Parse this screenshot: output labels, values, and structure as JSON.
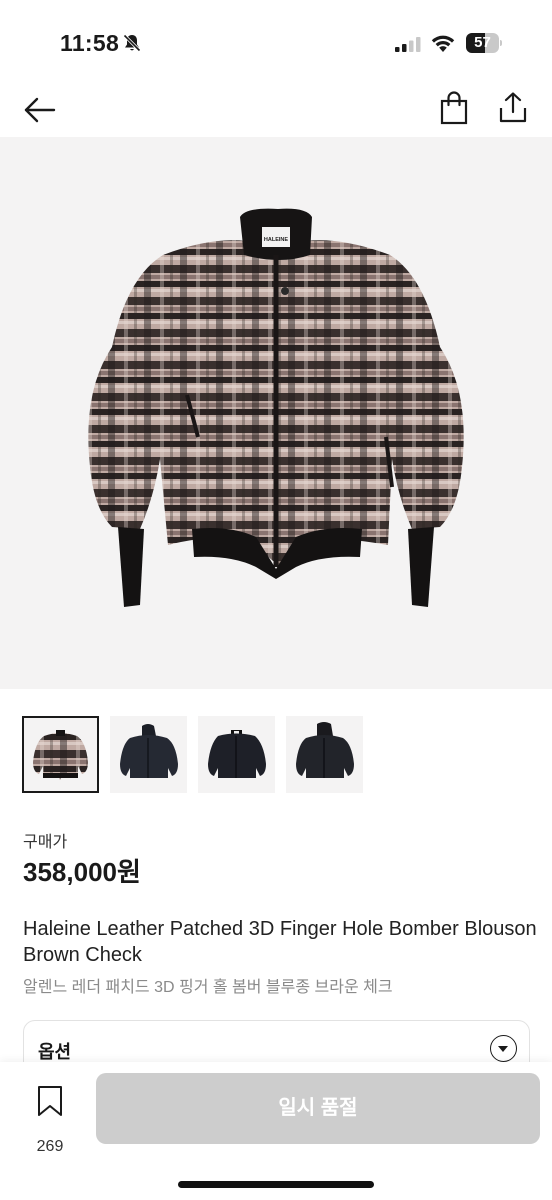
{
  "status_bar": {
    "time": "11:58",
    "battery": "57",
    "battery_level": 0.57,
    "icons": [
      "bell-slash-icon",
      "signal-icon",
      "wifi-icon",
      "battery-icon"
    ]
  },
  "nav": {
    "icons": [
      "arrow-left-icon",
      "shopping-bag-icon",
      "share-icon"
    ]
  },
  "product": {
    "brand_tag": "HALEINE",
    "thumbnails_count": 4,
    "selected_thumbnail": 0,
    "price_label": "구매가",
    "price": "358,000원",
    "title_en": "Haleine Leather Patched 3D Finger Hole Bomber Blouson Brown Check",
    "title_ko": "알렌느 레더 패치드 3D 핑거 홀 봄버 블루종 브라운 체크"
  },
  "options": {
    "label": "옵션",
    "icon": "chevron-down-icon"
  },
  "bottom_bar": {
    "wish_count": "269",
    "wish_icon": "bookmark-icon",
    "action_label": "일시 품절"
  },
  "colors": {
    "accent_disabled": "#cdcdcd",
    "text": "#1a1a1a",
    "muted": "#8a8a8a"
  }
}
